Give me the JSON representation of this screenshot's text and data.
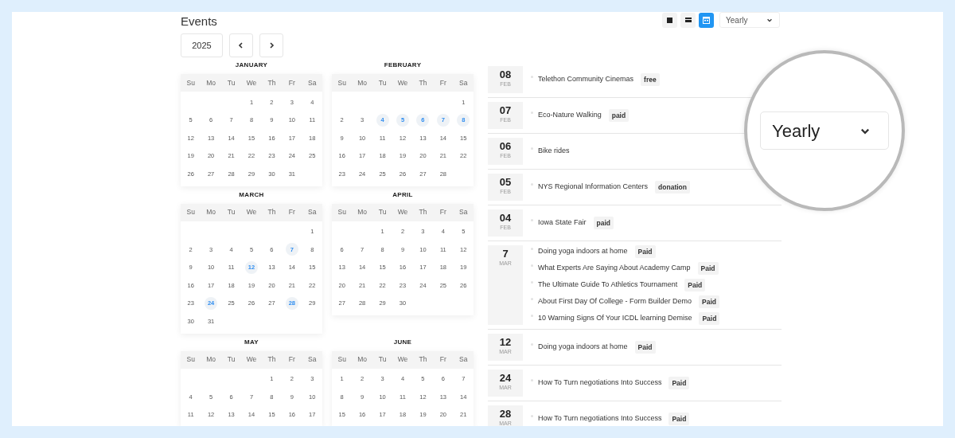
{
  "title": "Events",
  "toolbar": {
    "views": [
      {
        "kind": "square",
        "selected": false
      },
      {
        "kind": "bars",
        "selected": false
      },
      {
        "kind": "calendar",
        "selected": true
      }
    ],
    "period": "Yearly"
  },
  "year": {
    "value": "2025"
  },
  "months": [
    {
      "name": "JANUARY",
      "weekdays": [
        "Su",
        "Mo",
        "Tu",
        "We",
        "Th",
        "Fr",
        "Sa"
      ],
      "weeks": [
        {
          "right_aligned": true,
          "days": [
            {
              "day": "1",
              "event": false
            },
            {
              "day": "2",
              "event": false
            },
            {
              "day": "3",
              "event": false
            },
            {
              "day": "4",
              "event": false
            }
          ]
        },
        {
          "days": [
            {
              "day": "5",
              "event": false
            },
            {
              "day": "6",
              "event": false
            },
            {
              "day": "7",
              "event": false
            },
            {
              "day": "8",
              "event": false
            },
            {
              "day": "9",
              "event": false
            },
            {
              "day": "10",
              "event": false
            },
            {
              "day": "11",
              "event": false
            }
          ]
        },
        {
          "days": [
            {
              "day": "12",
              "event": false
            },
            {
              "day": "13",
              "event": false
            },
            {
              "day": "14",
              "event": false
            },
            {
              "day": "15",
              "event": false
            },
            {
              "day": "16",
              "event": false
            },
            {
              "day": "17",
              "event": false
            },
            {
              "day": "18",
              "event": false
            }
          ]
        },
        {
          "days": [
            {
              "day": "19",
              "event": false
            },
            {
              "day": "20",
              "event": false
            },
            {
              "day": "21",
              "event": false
            },
            {
              "day": "22",
              "event": false
            },
            {
              "day": "23",
              "event": false
            },
            {
              "day": "24",
              "event": false
            },
            {
              "day": "25",
              "event": false
            }
          ]
        },
        {
          "days": [
            {
              "day": "26",
              "event": false
            },
            {
              "day": "27",
              "event": false
            },
            {
              "day": "28",
              "event": false
            },
            {
              "day": "29",
              "event": false
            },
            {
              "day": "30",
              "event": false
            },
            {
              "day": "31",
              "event": false
            }
          ]
        }
      ]
    },
    {
      "name": "FEBRUARY",
      "weekdays": [
        "Su",
        "Mo",
        "Tu",
        "We",
        "Th",
        "Fr",
        "Sa"
      ],
      "weeks": [
        {
          "right_aligned": true,
          "days": [
            {
              "day": "1",
              "event": false
            }
          ]
        },
        {
          "days": [
            {
              "day": "2",
              "event": false
            },
            {
              "day": "3",
              "event": false
            },
            {
              "day": "4",
              "event": true
            },
            {
              "day": "5",
              "event": true
            },
            {
              "day": "6",
              "event": true
            },
            {
              "day": "7",
              "event": true
            },
            {
              "day": "8",
              "event": true
            }
          ]
        },
        {
          "days": [
            {
              "day": "9",
              "event": false
            },
            {
              "day": "10",
              "event": false
            },
            {
              "day": "11",
              "event": false
            },
            {
              "day": "12",
              "event": false
            },
            {
              "day": "13",
              "event": false
            },
            {
              "day": "14",
              "event": false
            },
            {
              "day": "15",
              "event": false
            }
          ]
        },
        {
          "days": [
            {
              "day": "16",
              "event": false
            },
            {
              "day": "17",
              "event": false
            },
            {
              "day": "18",
              "event": false
            },
            {
              "day": "19",
              "event": false
            },
            {
              "day": "20",
              "event": false
            },
            {
              "day": "21",
              "event": false
            },
            {
              "day": "22",
              "event": false
            }
          ]
        },
        {
          "days": [
            {
              "day": "23",
              "event": false
            },
            {
              "day": "24",
              "event": false
            },
            {
              "day": "25",
              "event": false
            },
            {
              "day": "26",
              "event": false
            },
            {
              "day": "27",
              "event": false
            },
            {
              "day": "28",
              "event": false
            }
          ]
        }
      ]
    },
    {
      "name": "MARCH",
      "weekdays": [
        "Su",
        "Mo",
        "Tu",
        "We",
        "Th",
        "Fr",
        "Sa"
      ],
      "weeks": [
        {
          "right_aligned": true,
          "days": [
            {
              "day": "1",
              "event": false
            }
          ]
        },
        {
          "days": [
            {
              "day": "2",
              "event": false
            },
            {
              "day": "3",
              "event": false
            },
            {
              "day": "4",
              "event": false
            },
            {
              "day": "5",
              "event": false
            },
            {
              "day": "6",
              "event": false
            },
            {
              "day": "7",
              "event": true
            },
            {
              "day": "8",
              "event": false
            }
          ]
        },
        {
          "days": [
            {
              "day": "9",
              "event": false
            },
            {
              "day": "10",
              "event": false
            },
            {
              "day": "11",
              "event": false
            },
            {
              "day": "12",
              "event": true
            },
            {
              "day": "13",
              "event": false
            },
            {
              "day": "14",
              "event": false
            },
            {
              "day": "15",
              "event": false
            }
          ]
        },
        {
          "days": [
            {
              "day": "16",
              "event": false
            },
            {
              "day": "17",
              "event": false
            },
            {
              "day": "18",
              "event": false
            },
            {
              "day": "19",
              "event": false
            },
            {
              "day": "20",
              "event": false
            },
            {
              "day": "21",
              "event": false
            },
            {
              "day": "22",
              "event": false
            }
          ]
        },
        {
          "days": [
            {
              "day": "23",
              "event": false
            },
            {
              "day": "24",
              "event": true
            },
            {
              "day": "25",
              "event": false
            },
            {
              "day": "26",
              "event": false
            },
            {
              "day": "27",
              "event": false
            },
            {
              "day": "28",
              "event": true
            },
            {
              "day": "29",
              "event": false
            }
          ]
        },
        {
          "days": [
            {
              "day": "30",
              "event": false
            },
            {
              "day": "31",
              "event": false
            }
          ]
        }
      ]
    },
    {
      "name": "APRIL",
      "weekdays": [
        "Su",
        "Mo",
        "Tu",
        "We",
        "Th",
        "Fr",
        "Sa"
      ],
      "weeks": [
        {
          "right_aligned": true,
          "days": [
            {
              "day": "1",
              "event": false
            },
            {
              "day": "2",
              "event": false
            },
            {
              "day": "3",
              "event": false
            },
            {
              "day": "4",
              "event": false
            },
            {
              "day": "5",
              "event": false
            }
          ]
        },
        {
          "days": [
            {
              "day": "6",
              "event": false
            },
            {
              "day": "7",
              "event": false
            },
            {
              "day": "8",
              "event": false
            },
            {
              "day": "9",
              "event": false
            },
            {
              "day": "10",
              "event": false
            },
            {
              "day": "11",
              "event": false
            },
            {
              "day": "12",
              "event": false
            }
          ]
        },
        {
          "days": [
            {
              "day": "13",
              "event": false
            },
            {
              "day": "14",
              "event": false
            },
            {
              "day": "15",
              "event": false
            },
            {
              "day": "16",
              "event": false
            },
            {
              "day": "17",
              "event": false
            },
            {
              "day": "18",
              "event": false
            },
            {
              "day": "19",
              "event": false
            }
          ]
        },
        {
          "days": [
            {
              "day": "20",
              "event": false
            },
            {
              "day": "21",
              "event": false
            },
            {
              "day": "22",
              "event": false
            },
            {
              "day": "23",
              "event": false
            },
            {
              "day": "24",
              "event": false
            },
            {
              "day": "25",
              "event": false
            },
            {
              "day": "26",
              "event": false
            }
          ]
        },
        {
          "days": [
            {
              "day": "27",
              "event": false
            },
            {
              "day": "28",
              "event": false
            },
            {
              "day": "29",
              "event": false
            },
            {
              "day": "30",
              "event": false
            }
          ]
        }
      ]
    },
    {
      "name": "MAY",
      "weekdays": [
        "Su",
        "Mo",
        "Tu",
        "We",
        "Th",
        "Fr",
        "Sa"
      ],
      "weeks": [
        {
          "right_aligned": true,
          "days": [
            {
              "day": "1",
              "event": false
            },
            {
              "day": "2",
              "event": false
            },
            {
              "day": "3",
              "event": false
            }
          ]
        },
        {
          "days": [
            {
              "day": "4",
              "event": false
            },
            {
              "day": "5",
              "event": false
            },
            {
              "day": "6",
              "event": false
            },
            {
              "day": "7",
              "event": false
            },
            {
              "day": "8",
              "event": false
            },
            {
              "day": "9",
              "event": false
            },
            {
              "day": "10",
              "event": false
            }
          ]
        },
        {
          "days": [
            {
              "day": "11",
              "event": false
            },
            {
              "day": "12",
              "event": false
            },
            {
              "day": "13",
              "event": false
            },
            {
              "day": "14",
              "event": false
            },
            {
              "day": "15",
              "event": false
            },
            {
              "day": "16",
              "event": false
            },
            {
              "day": "17",
              "event": false
            }
          ]
        }
      ]
    },
    {
      "name": "JUNE",
      "weekdays": [
        "Su",
        "Mo",
        "Tu",
        "We",
        "Th",
        "Fr",
        "Sa"
      ],
      "weeks": [
        {
          "days": [
            {
              "day": "1",
              "event": false
            },
            {
              "day": "2",
              "event": false
            },
            {
              "day": "3",
              "event": false
            },
            {
              "day": "4",
              "event": false
            },
            {
              "day": "5",
              "event": false
            },
            {
              "day": "6",
              "event": false
            },
            {
              "day": "7",
              "event": false
            }
          ]
        },
        {
          "days": [
            {
              "day": "8",
              "event": false
            },
            {
              "day": "9",
              "event": false
            },
            {
              "day": "10",
              "event": false
            },
            {
              "day": "11",
              "event": false
            },
            {
              "day": "12",
              "event": false
            },
            {
              "day": "13",
              "event": false
            },
            {
              "day": "14",
              "event": false
            }
          ]
        },
        {
          "days": [
            {
              "day": "15",
              "event": false
            },
            {
              "day": "16",
              "event": false
            },
            {
              "day": "17",
              "event": false
            },
            {
              "day": "18",
              "event": false
            },
            {
              "day": "19",
              "event": false
            },
            {
              "day": "20",
              "event": false
            },
            {
              "day": "21",
              "event": false
            }
          ]
        }
      ]
    }
  ],
  "agenda": [
    {
      "day": "08",
      "month": "FEB",
      "events": [
        {
          "title": "Telethon Community Cinemas",
          "tag": "free"
        }
      ]
    },
    {
      "day": "07",
      "month": "FEB",
      "events": [
        {
          "title": "Eco-Nature Walking",
          "tag": "paid"
        }
      ]
    },
    {
      "day": "06",
      "month": "FEB",
      "events": [
        {
          "title": "Bike rides"
        }
      ]
    },
    {
      "day": "05",
      "month": "FEB",
      "events": [
        {
          "title": "NYS Regional Information Centers",
          "tag": "donation"
        }
      ]
    },
    {
      "day": "04",
      "month": "FEB",
      "events": [
        {
          "title": "Iowa State Fair",
          "tag": "paid"
        }
      ]
    },
    {
      "day": "7",
      "month": "MAR",
      "events": [
        {
          "title": "Doing yoga indoors at home",
          "tag": "Paid"
        },
        {
          "title": "What Experts Are Saying About Academy Camp",
          "tag": "Paid"
        },
        {
          "title": "The Ultimate Guide To Athletics Tournament",
          "tag": "Paid"
        },
        {
          "title": "About First Day Of College - Form Builder Demo",
          "tag": "Paid"
        },
        {
          "title": "10 Warning Signs Of Your ICDL learning Demise",
          "tag": "Paid"
        }
      ]
    },
    {
      "day": "12",
      "month": "MAR",
      "events": [
        {
          "title": "Doing yoga indoors at home",
          "tag": "Paid"
        }
      ]
    },
    {
      "day": "24",
      "month": "MAR",
      "events": [
        {
          "title": "How To Turn negotiations Into Success",
          "tag": "Paid"
        }
      ]
    },
    {
      "day": "28",
      "month": "MAR",
      "events": [
        {
          "title": "How To Turn negotiations Into Success",
          "tag": "Paid"
        }
      ]
    }
  ],
  "magnifier": {
    "period": "Yearly"
  }
}
